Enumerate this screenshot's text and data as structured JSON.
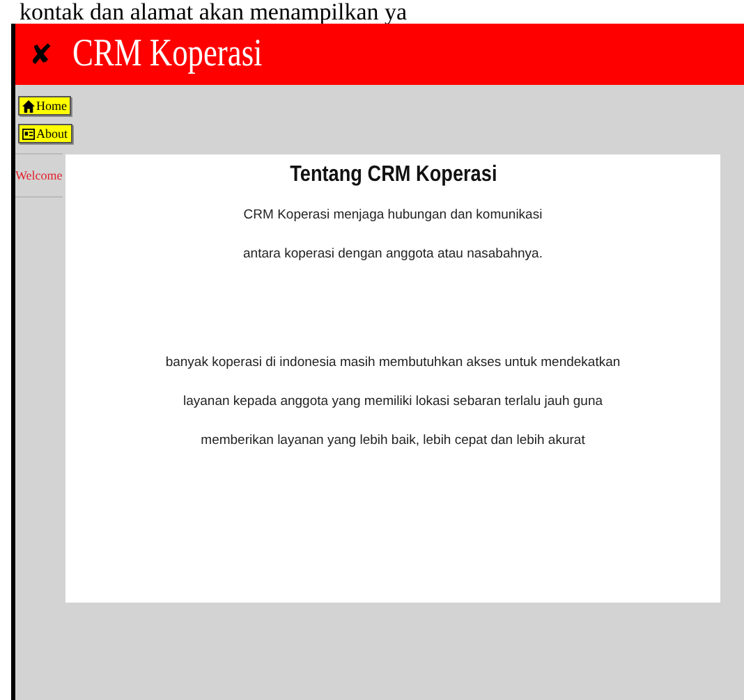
{
  "document_text": "kontak dan alamat akan menampilkan ya",
  "header": {
    "close_icon": "✘",
    "title": "CRM Koperasi"
  },
  "sidebar": {
    "items": [
      {
        "kind": "button",
        "label": "Home"
      },
      {
        "kind": "button",
        "label": "About"
      },
      {
        "kind": "link",
        "label": "Welcome"
      }
    ]
  },
  "content": {
    "title": "Tentang CRM Koperasi",
    "paragraphs": [
      "CRM Koperasi menjaga hubungan dan komunikasi",
      "antara koperasi dengan anggota atau nasabahnya.",
      "banyak koperasi di indonesia masih membutuhkan akses untuk mendekatkan",
      "layanan kepada anggota yang memiliki lokasi sebaran terlalu jauh guna",
      "memberikan layanan yang lebih baik, lebih cepat dan lebih akurat"
    ]
  }
}
